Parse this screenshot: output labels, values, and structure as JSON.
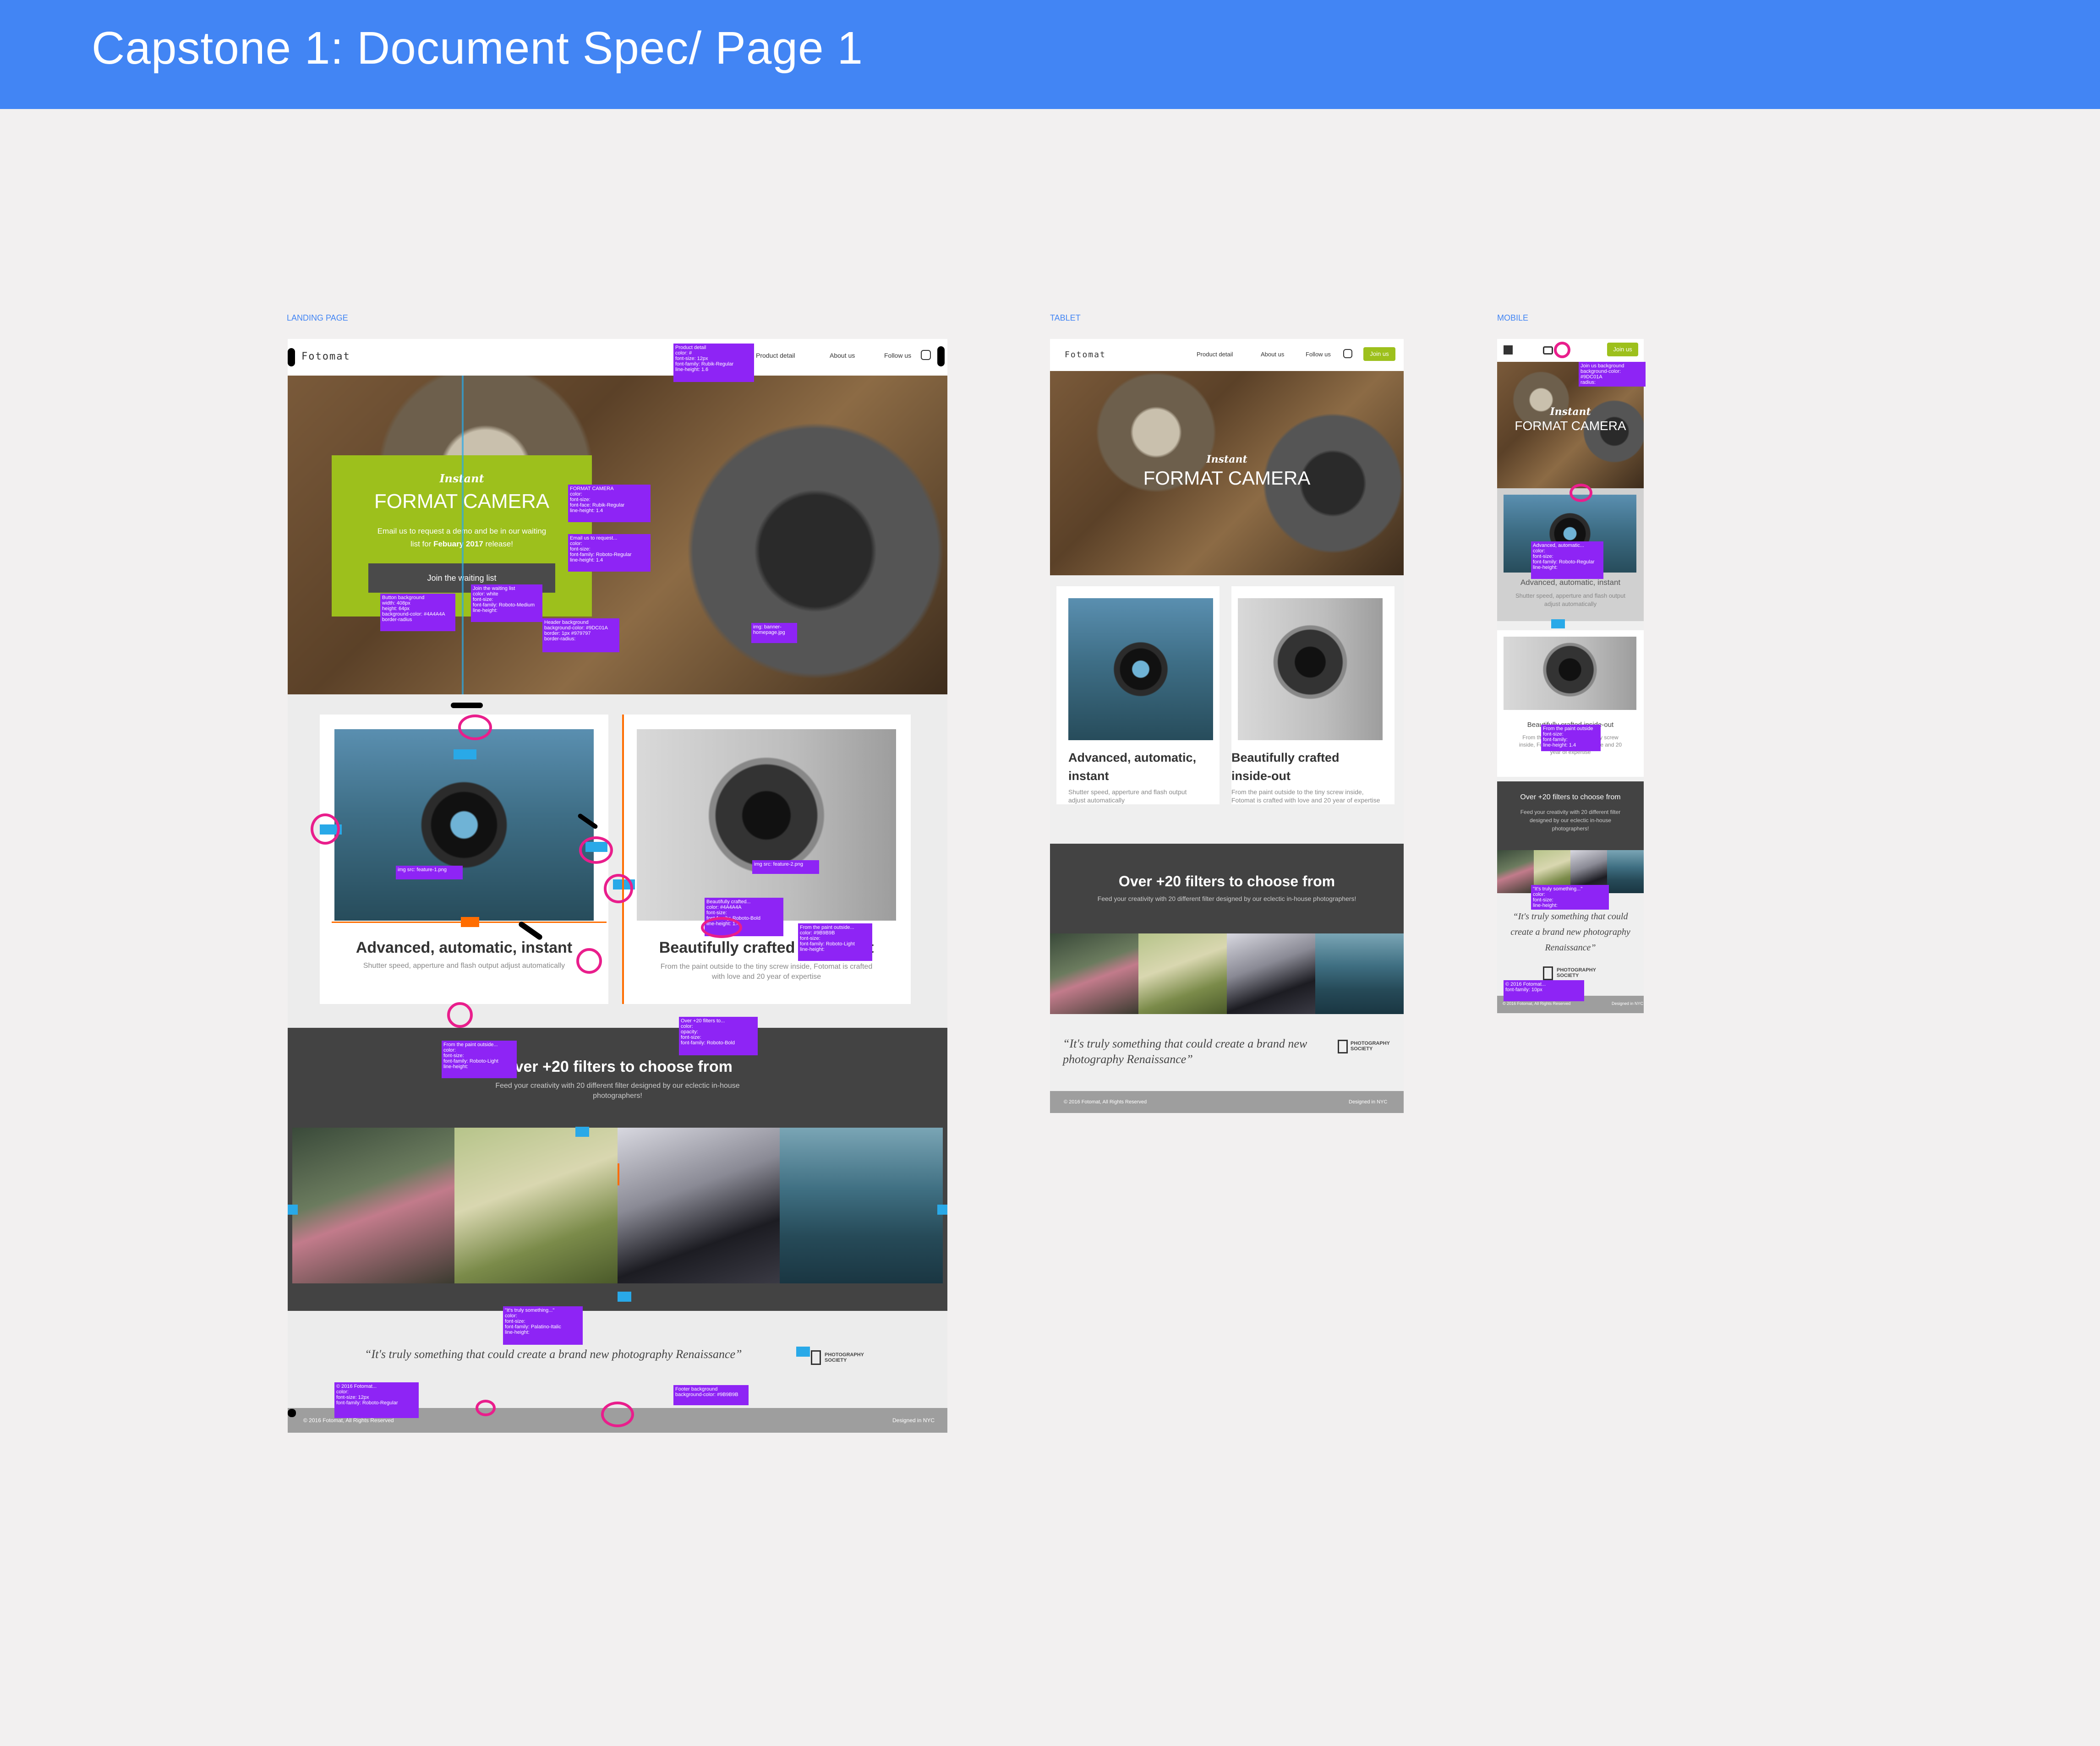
{
  "header": {
    "title": "Capstone 1: Document Spec/ Page 1"
  },
  "frames": {
    "landing": "LANDING PAGE",
    "tablet": "TABLET",
    "mobile": "MOBILE"
  },
  "site": {
    "logo": "Fotomat",
    "nav": {
      "product": "Product detail",
      "about": "About us",
      "follow": "Follow us",
      "join": "Join us"
    },
    "hero": {
      "kicker": "Instant",
      "title": "FORMAT CAMERA",
      "text_before": "Email us to request a demo and be in our waiting list for ",
      "text_bold": "Febuary 2017",
      "text_after": " release!",
      "button": "Join the waiting list"
    },
    "cards": [
      {
        "title": "Advanced, automatic, instant",
        "text": "Shutter speed, apperture and flash output adjust automatically"
      },
      {
        "title": "Beautifully crafted inside-out",
        "text": "From the paint outside to the tiny screw inside, Fotomat is crafted with love and 20 year of expertise"
      }
    ],
    "filters": {
      "title": "Over +20 filters to choose from",
      "text": "Feed your creativity with 20 different filter designed by our eclectic in-house photographers!"
    },
    "quote": "“It's truly something that could create a brand new photography Renaissance”",
    "society": {
      "line1": "PHOTOGRAPHY",
      "line2": "SOCIETY"
    },
    "footer": {
      "left": "© 2016 Fotomat, All Rights Reserved",
      "right": "Designed in NYC"
    }
  },
  "annotations": {
    "nav": "Product detail\ncolor: #\nfont-size: 12px\nfont-family: Rubik-Regular\nline-height: 1.6",
    "hero_title": "FORMAT CAMERA\ncolor:\nfont-size:\nfont-face: Rubik-Regular\nline-height: 1.4",
    "hero_text": "Email us to request...\ncolor:\nfont-size:\nfont-family: Roboto-Regular\nline-height: 1.4",
    "button": "Button background\nwidth: 408px\nheight: 64px\nbackground-color: #4A4A4A\nborder-radius",
    "join": "Join the waiting list\ncolor: white\nfont-size:\nfont-family: Roboto-Medium\nline-height:",
    "header_bg": "Header background\nbackground-color: #9DC01A\nborder: 1px #979797\nborder-radius:",
    "banner": "img: banner-\nhomepage.jpg",
    "img1": "img src: feature-1.png",
    "img2": "img src: feature-2.png",
    "crafted": "Beautifully crafted...\ncolor: #4A4A4A\nfont-size:\nfont-family: Roboto-Bold\nline-height: 1.4",
    "paint1": "From the paint outside...\ncolor: #9B9B9B\nfont-size:\nfont-family: Roboto-Light\nline-height:",
    "paint2": "From the paint outside...\ncolor:\nfont-size:\nfont-family: Roboto-Light\nline-height:",
    "over": "Over +20 filters to...\ncolor:\nopacity:\nfont-size:\nfont-family: Roboto-Bold",
    "quote": "\"It's truly something...\"\ncolor:\nfont-size:\nfont-family: Palatino-Italic\nline-height:",
    "copyright": "© 2016 Fotomat...\ncolor:\nfont-size: 12px\nfont-family: Roboto-Regular",
    "footer_bg": "Footer background\nbackground-color: #9B9B9B",
    "mobile_join": "Join us background\nbackground-color: #9DC01A\nradius:",
    "mobile_adv": "Advanced, automatic...\ncolor:\nfont-size:\nfont-family: Roboto-Regular\nline-height:",
    "mobile_paint": "From the paint outside\nfont-size:\nfont-family:\nline-height: 1.4",
    "mobile_quote": "\"It's truly something...\"\ncolor:\nfont-size:\nline-height:",
    "mobile_copy": "© 2016 Fotomat...\nfont-family: 10px"
  },
  "colors": {
    "brand_green": "#9dc01c",
    "dark": "#434343",
    "header_blue": "#4285f4",
    "annotation": "#8e24f5",
    "markup_pink": "#e91e8c"
  },
  "icons": [
    "instagram-icon",
    "camera-icon",
    "photography-society-logo"
  ]
}
